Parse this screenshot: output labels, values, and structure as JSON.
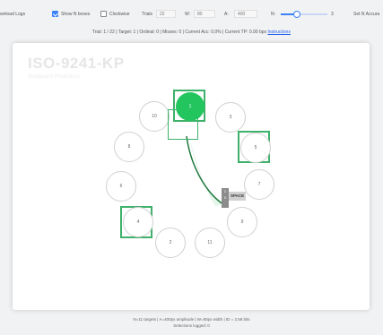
{
  "toolbar": {
    "download_label": "wnload Logs",
    "show_n_boxes_label": "Show N boxes",
    "show_n_boxes_checked": true,
    "clockwise_label": "Clockwise",
    "clockwise_checked": false,
    "trials_label": "Trials",
    "trials_value": "22",
    "w_label": "W:",
    "w_value": "80",
    "a_label": "A:",
    "a_value": "400",
    "n_label": "N:",
    "n_value": "3",
    "n_fraction": 0.35,
    "set_n_label": "Set N Accura"
  },
  "status": {
    "text": "Trial: 1 / 22 | Target: 1 | Ordinal: 0 | Misses: 0 | Current Acc: 0.0% | Current TP: 0.00 bps",
    "link": "Instructions"
  },
  "canvas": {
    "title": "ISO-9241-KP",
    "subtitle": "(Keyboard Prediction)",
    "targets": [
      "1",
      "3",
      "5",
      "7",
      "9",
      "11",
      "2",
      "4",
      "6",
      "8",
      "10"
    ],
    "keys": [
      "2",
      "X"
    ],
    "space_label": "SPACE"
  },
  "colors": {
    "accent": "#3b82f6",
    "active_target": "#22c55e",
    "highlight_box": "#3eb16a"
  },
  "footer": {
    "line1": "N=11 targets | A=400px amplitude | W=80px width | ID = 2.58 bits",
    "line2": "Selections logged: 0"
  }
}
